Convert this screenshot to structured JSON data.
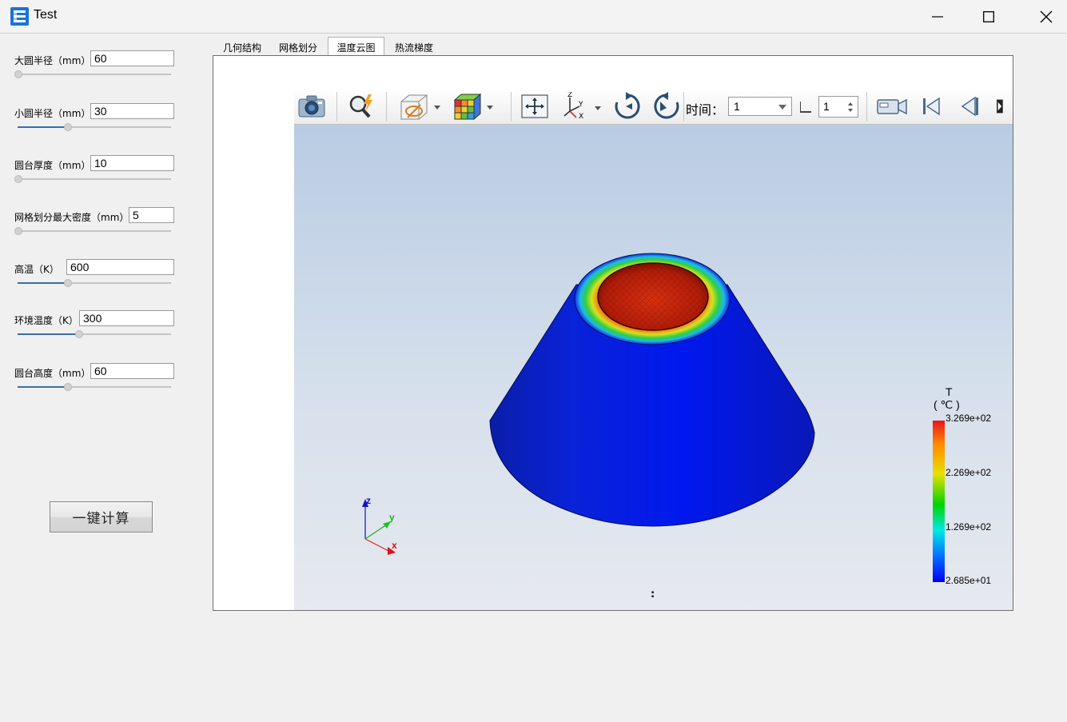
{
  "window": {
    "title": "Test"
  },
  "params": [
    {
      "label": "大圆半径（mm）",
      "value": "60",
      "slider": 0.0
    },
    {
      "label": "小圆半径（mm）",
      "value": "30",
      "slider": 0.33
    },
    {
      "label": "圆台厚度（mm）",
      "value": "10",
      "slider": 0.0
    },
    {
      "label": "网格划分最大密度（mm）",
      "value": "5",
      "slider": 0.0
    },
    {
      "label": "高温（K）",
      "value": "600",
      "slider": 0.33
    },
    {
      "label": "环境温度（K）",
      "value": "300",
      "slider": 0.4
    },
    {
      "label": "圆台高度（mm）",
      "value": "60",
      "slider": 0.33
    }
  ],
  "calc_button": "一键计算",
  "tabs": [
    "几何结构",
    "网格划分",
    "温度云图",
    "热流梯度"
  ],
  "active_tab": 2,
  "toolbar": {
    "time_label": "时间：",
    "time_value": "1",
    "step_value": "1"
  },
  "legend": {
    "title_line1": "T",
    "title_line2": "( ℃ )",
    "ticks": [
      "3.269e+02",
      "2.269e+02",
      "1.269e+02",
      "2.685e+01"
    ]
  },
  "axes": {
    "x": "x",
    "y": "y",
    "z": "z"
  },
  "scene_footer": ":"
}
